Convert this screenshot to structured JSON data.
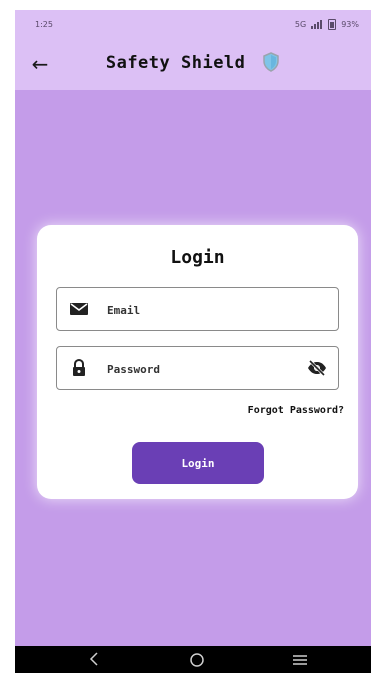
{
  "status_bar": {
    "time": "1:25",
    "network": "5G",
    "battery": "93%"
  },
  "app_bar": {
    "title": "Safety Shield"
  },
  "login_card": {
    "title": "Login",
    "email_placeholder": "Email",
    "password_placeholder": "Password",
    "forgot_password": "Forgot Password?",
    "login_button": "Login"
  },
  "colors": {
    "background": "#c49ce9",
    "app_bar": "#dcc0f5",
    "button": "#6a3fb5",
    "card": "#ffffff"
  },
  "icons": {
    "back": "arrow-left-icon",
    "shield": "shield-icon",
    "email": "mail-icon",
    "password": "lock-icon",
    "visibility": "eye-off-icon"
  }
}
